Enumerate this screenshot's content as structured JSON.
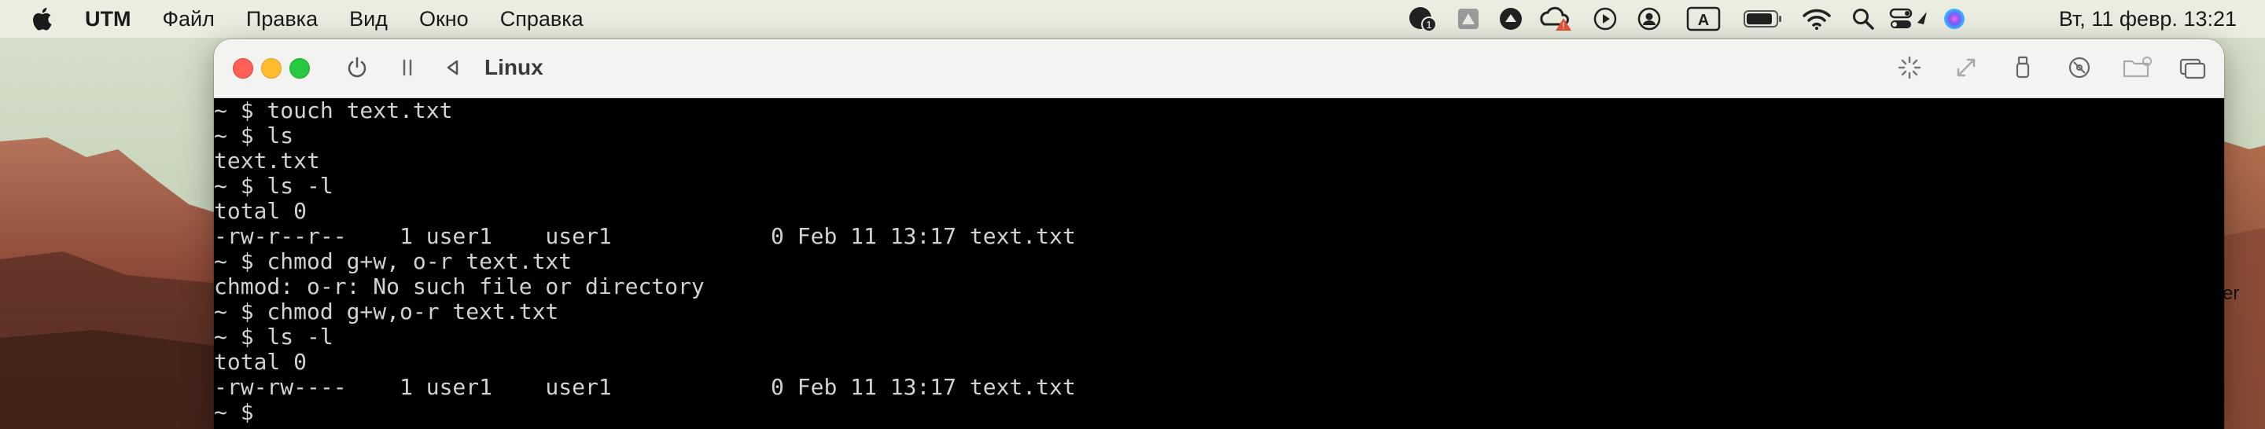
{
  "menubar": {
    "apple_icon": "apple-icon",
    "items": [
      {
        "label": "UTM",
        "bold": true
      },
      {
        "label": "Файл"
      },
      {
        "label": "Правка"
      },
      {
        "label": "Вид"
      },
      {
        "label": "Окно"
      },
      {
        "label": "Справка"
      }
    ],
    "status_icons": [
      "notification-count-icon",
      "drive-icon",
      "browser-extension-icon",
      "creative-cloud-icon",
      "play-icon",
      "user-icon",
      "input-source-icon",
      "battery-icon",
      "wifi-icon",
      "search-icon",
      "control-center-icon",
      "siri-icon"
    ],
    "notification_count": "1",
    "input_source_label": "A",
    "clock": "Вт, 11 февр.  13:21"
  },
  "desktop": {
    "edge_label": "er"
  },
  "window": {
    "title": "Linux",
    "toolbar_icons": [
      "power-icon",
      "pause-icon",
      "back-icon",
      "capture-input-icon",
      "resize-icon",
      "usb-icon",
      "cd-drive-icon",
      "shared-folder-icon",
      "windows-icon"
    ]
  },
  "terminal": {
    "lines": [
      "~ $ touch text.txt",
      "~ $ ls",
      "text.txt",
      "~ $ ls -l",
      "total 0",
      "-rw-r--r--    1 user1    user1            0 Feb 11 13:17 text.txt",
      "~ $ chmod g+w, o-r text.txt",
      "chmod: o-r: No such file or directory",
      "~ $ chmod g+w,o-r text.txt",
      "~ $ ls -l",
      "total 0",
      "-rw-rw----    1 user1    user1            0 Feb 11 13:17 text.txt",
      "~ $ "
    ]
  }
}
